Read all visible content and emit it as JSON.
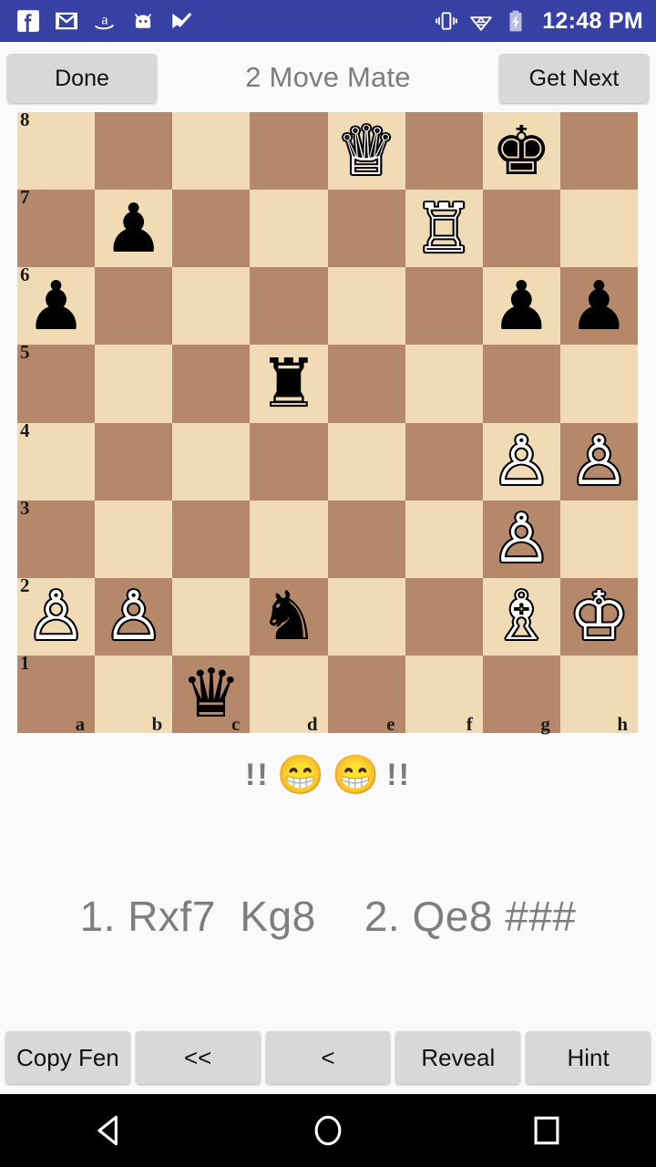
{
  "status_bar": {
    "background": "#3741a3",
    "time": "12:48 PM",
    "left_icons": [
      "facebook-icon",
      "gmail-icon",
      "amazon-icon",
      "android-icon",
      "check-mail-icon"
    ],
    "right_icons": [
      "vibrate-icon",
      "wifi-icon",
      "battery-charging-icon"
    ]
  },
  "title_bar": {
    "done_label": "Done",
    "title": "2 Move Mate",
    "get_next_label": "Get Next"
  },
  "board": {
    "light_color": "#f0dbb4",
    "dark_color": "#b5886a",
    "ranks": [
      "8",
      "7",
      "6",
      "5",
      "4",
      "3",
      "2",
      "1"
    ],
    "files": [
      "a",
      "b",
      "c",
      "d",
      "e",
      "f",
      "g",
      "h"
    ],
    "orientation": "white-bottom",
    "pieces": [
      {
        "square": "e8",
        "color": "white",
        "type": "queen",
        "glyph": "♕"
      },
      {
        "square": "g8",
        "color": "black",
        "type": "king",
        "glyph": "♚"
      },
      {
        "square": "b7",
        "color": "black",
        "type": "pawn",
        "glyph": "♟"
      },
      {
        "square": "f7",
        "color": "white",
        "type": "rook",
        "glyph": "♖"
      },
      {
        "square": "a6",
        "color": "black",
        "type": "pawn",
        "glyph": "♟"
      },
      {
        "square": "g6",
        "color": "black",
        "type": "pawn",
        "glyph": "♟"
      },
      {
        "square": "h6",
        "color": "black",
        "type": "pawn",
        "glyph": "♟"
      },
      {
        "square": "d5",
        "color": "black",
        "type": "rook",
        "glyph": "♜"
      },
      {
        "square": "g4",
        "color": "white",
        "type": "pawn",
        "glyph": "♙"
      },
      {
        "square": "h4",
        "color": "white",
        "type": "pawn",
        "glyph": "♙"
      },
      {
        "square": "g3",
        "color": "white",
        "type": "pawn",
        "glyph": "♙"
      },
      {
        "square": "a2",
        "color": "white",
        "type": "pawn",
        "glyph": "♙"
      },
      {
        "square": "b2",
        "color": "white",
        "type": "pawn",
        "glyph": "♙"
      },
      {
        "square": "d2",
        "color": "black",
        "type": "knight",
        "glyph": "♞"
      },
      {
        "square": "g2",
        "color": "white",
        "type": "bishop",
        "glyph": "♗"
      },
      {
        "square": "h2",
        "color": "white",
        "type": "king",
        "glyph": "♔"
      },
      {
        "square": "c1",
        "color": "black",
        "type": "queen",
        "glyph": "♛"
      }
    ]
  },
  "rating_row": {
    "left_marks": "!!",
    "right_marks": "!!",
    "emoji_1": "😁",
    "emoji_2": "😁",
    "emoji_name": "grinning-face-with-smiling-eyes"
  },
  "move_list": {
    "text": "1. Rxf7  Kg8    2. Qe8 ###"
  },
  "bottom_bar": {
    "buttons": [
      {
        "label": "Copy Fen",
        "name": "copy-fen-button"
      },
      {
        "label": "<<",
        "name": "first-move-button"
      },
      {
        "label": "<",
        "name": "previous-move-button"
      },
      {
        "label": "Reveal",
        "name": "reveal-button"
      },
      {
        "label": "Hint",
        "name": "hint-button"
      }
    ]
  },
  "nav_bar": {
    "background": "#000000",
    "buttons": [
      "back-icon",
      "home-icon",
      "recents-icon"
    ]
  }
}
